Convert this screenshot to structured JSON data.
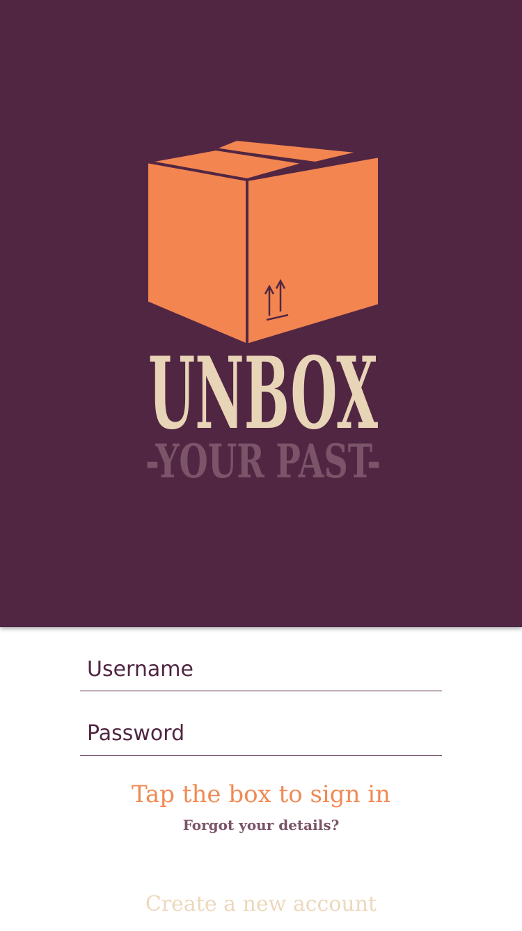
{
  "branding": {
    "logo_line1": "UNBOX",
    "logo_line2": "-YOUR PAST-",
    "colors": {
      "background": "#512643",
      "box": "#f28550",
      "cream": "#e8d4b6",
      "muted": "#7b5469"
    }
  },
  "form": {
    "username_placeholder": "Username",
    "password_placeholder": "Password"
  },
  "actions": {
    "sign_in_hint": "Tap the box to sign in",
    "forgot": "Forgot your details?",
    "create": "Create a new account"
  },
  "icons": {
    "box": "box-icon",
    "this_side_up": "this-side-up-arrows-icon"
  }
}
